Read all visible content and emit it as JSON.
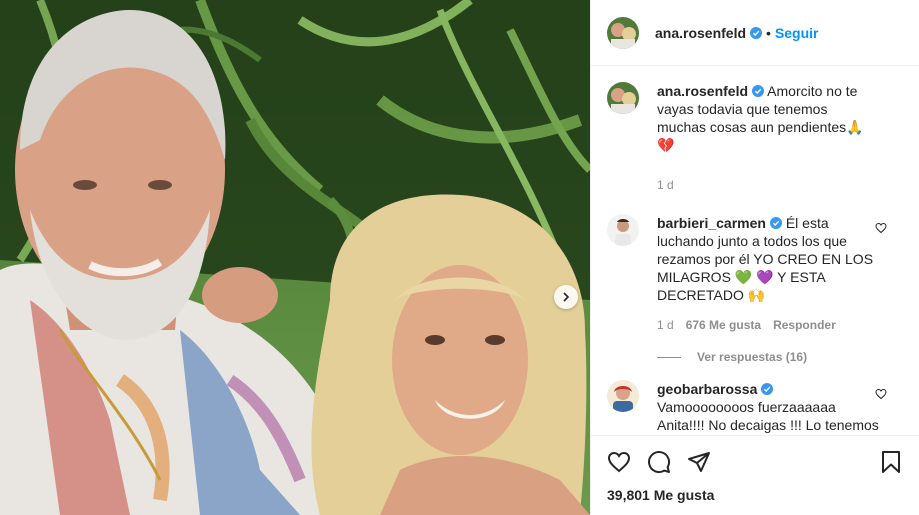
{
  "post": {
    "author": "ana.rosenfeld",
    "follow_label": "Seguir",
    "separator": "•"
  },
  "caption": {
    "username": "ana.rosenfeld",
    "text": "Amorcito no te vayas todavia que tenemos muchas cosas aun pendientes🙏💔",
    "time": "1 d"
  },
  "comments": [
    {
      "username": "barbieri_carmen",
      "text": "Él esta luchando junto a todos los que rezamos por él YO CREO EN LOS MILAGROS 💚 💜 Y ESTA DECRETADO 🙌",
      "time": "1 d",
      "likes": "676 Me gusta",
      "reply_label": "Responder",
      "view_replies": "Ver respuestas (16)"
    },
    {
      "username": "geobarbarossa",
      "text": "Vamoooooooos fuerzaaaaaa Anita!!!! No decaigas !!! Lo tenemos en oración 🙌🙌🙌🙌"
    }
  ],
  "footer": {
    "likes": "39,801 Me gusta"
  },
  "colors": {
    "accent": "#0095f6",
    "verified": "#3897f0",
    "muted": "#8e8e8e",
    "border": "#efefef"
  },
  "icons": [
    "verified-badge-icon",
    "heart-icon",
    "comment-icon",
    "share-icon",
    "bookmark-icon",
    "chevron-right-icon"
  ]
}
